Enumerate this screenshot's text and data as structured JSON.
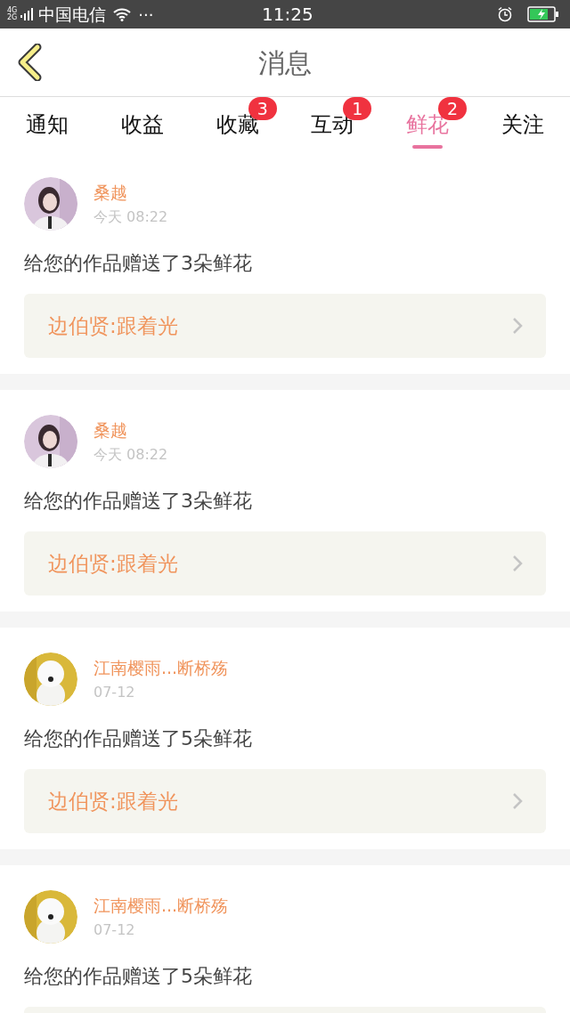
{
  "status_bar": {
    "network_top": "4G",
    "network_bottom": "2G",
    "carrier": "中国电信",
    "more": "···",
    "time": "11:25"
  },
  "header": {
    "title": "消息"
  },
  "tabs": [
    {
      "label": "通知",
      "selected": false
    },
    {
      "label": "收益",
      "selected": false
    },
    {
      "label": "收藏",
      "selected": false,
      "badge": "3"
    },
    {
      "label": "互动",
      "selected": false,
      "badge": "1"
    },
    {
      "label": "鲜花",
      "selected": true,
      "badge": "2"
    },
    {
      "label": "关注",
      "selected": false
    }
  ],
  "messages": [
    {
      "name": "桑越",
      "time": "今天 08:22",
      "text": "给您的作品赠送了3朵鲜花",
      "link": "边伯贤:跟着光"
    },
    {
      "name": "桑越",
      "time": "今天 08:22",
      "text": "给您的作品赠送了3朵鲜花",
      "link": "边伯贤:跟着光"
    },
    {
      "name": "江南樱雨...断桥殇",
      "time": "07-12",
      "text": "给您的作品赠送了5朵鲜花",
      "link": "边伯贤:跟着光"
    },
    {
      "name": "江南樱雨...断桥殇",
      "time": "07-12",
      "text": "给您的作品赠送了5朵鲜花"
    }
  ]
}
